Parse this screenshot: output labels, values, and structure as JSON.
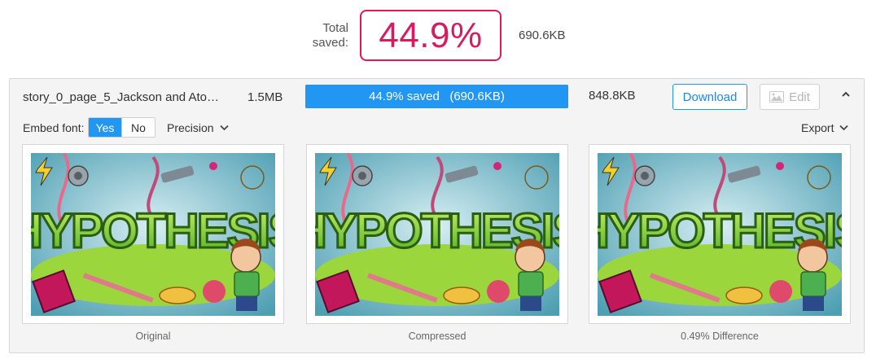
{
  "summary": {
    "total_label": "Total saved:",
    "total_percent": "44.9%",
    "total_size": "690.6KB"
  },
  "file": {
    "name": "story_0_page_5_Jackson and Ato…",
    "original_size": "1.5MB",
    "progress_text": "44.9% saved   (690.6KB)",
    "saved_fraction": 0.449,
    "new_size": "848.8KB",
    "download_label": "Download",
    "edit_label": "Edit"
  },
  "options": {
    "embed_font_label": "Embed font:",
    "embed_yes": "Yes",
    "embed_no": "No",
    "embed_selected": "Yes",
    "precision_label": "Precision",
    "export_label": "Export"
  },
  "previews": [
    {
      "caption": "Original",
      "artwork_text": "HYPOTHESIS"
    },
    {
      "caption": "Compressed",
      "artwork_text": "HYPOTHESIS"
    },
    {
      "caption": "0.49% Difference",
      "artwork_text": "HYPOTHESIS"
    }
  ],
  "colors": {
    "accent": "#2196f3",
    "highlight": "#d81b60",
    "art_green": "#7ed321",
    "art_bg": "#6fb4c4"
  },
  "icons": {
    "edit": "image-icon",
    "collapse": "chevron-up-icon",
    "precision": "chevron-down-icon",
    "export": "chevron-down-icon"
  }
}
